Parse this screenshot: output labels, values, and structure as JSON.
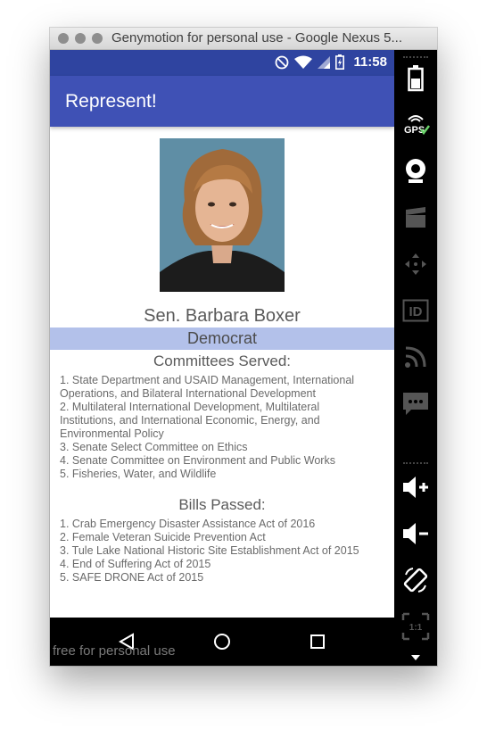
{
  "window": {
    "title": "Genymotion for personal use - Google Nexus 5..."
  },
  "status_bar": {
    "time": "11:58"
  },
  "app": {
    "title": "Represent!"
  },
  "profile": {
    "name": "Sen. Barbara Boxer",
    "party": "Democrat"
  },
  "committees": {
    "heading": "Committees Served:",
    "items": [
      "1. State Department and USAID Management, International",
      "Operations, and Bilateral International Development",
      "2. Multilateral International Development, Multilateral",
      "Institutions, and International Economic, Energy, and",
      "Environmental Policy",
      "3. Senate Select Committee on Ethics",
      "4. Senate Committee on Environment and Public Works",
      "5. Fisheries, Water, and Wildlife"
    ]
  },
  "bills": {
    "heading": "Bills Passed:",
    "items": [
      "1. Crab Emergency Disaster Assistance Act of 2016",
      "2. Female Veteran Suicide Prevention Act",
      "3. Tule Lake National Historic Site Establishment Act of 2015",
      "4. End of Suffering Act of 2015",
      "5. SAFE DRONE Act of 2015"
    ]
  },
  "watermark": "free for personal use",
  "sidebar": {
    "gps_label": "GPS",
    "id_label": "ID",
    "scale_label": "1:1"
  },
  "colors": {
    "status_bar": "#2f44a0",
    "app_bar": "#3f51b5",
    "party_band": "#b3c1ea"
  }
}
